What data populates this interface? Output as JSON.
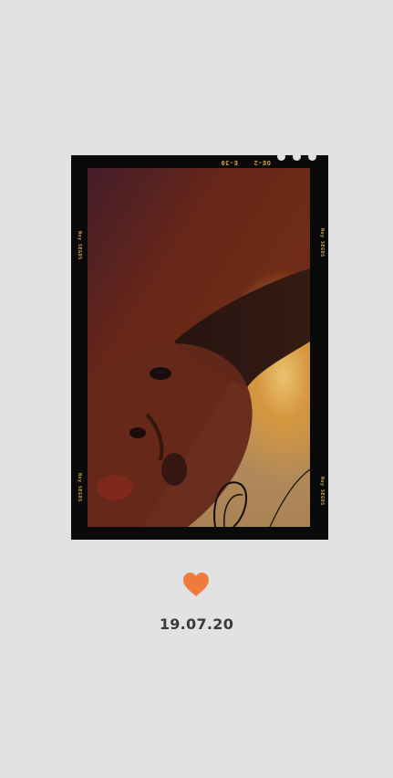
{
  "film": {
    "edge_code_1": "E-30",
    "edge_code_2": "OE-2",
    "side_code": "Noy SEGOS"
  },
  "caption": {
    "icon": "heart-icon",
    "heart_color": "#f07a3c",
    "date": "19.07.20"
  },
  "colors": {
    "background": "#e2e2e2",
    "frame": "#0a0a0a",
    "edge_text": "#d2a54a"
  }
}
